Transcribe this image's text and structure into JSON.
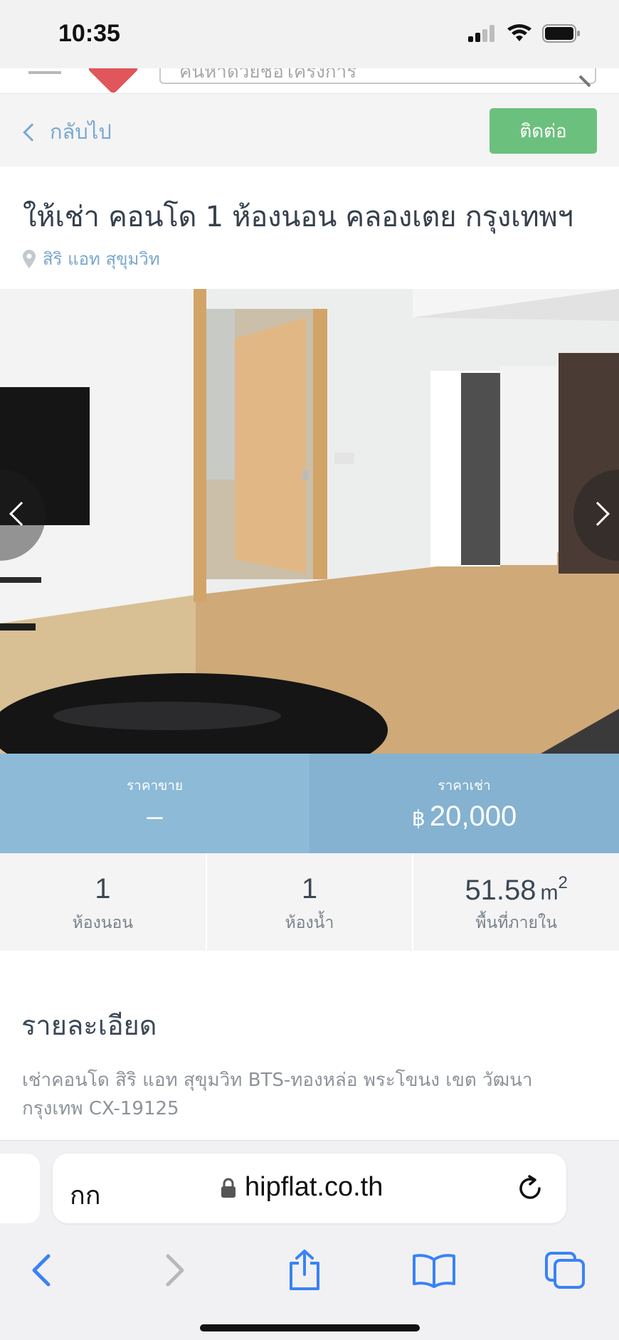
{
  "status_bar": {
    "time": "10:35"
  },
  "header": {
    "search_placeholder": "ค้นหาด้วยชื่อโครงการ"
  },
  "action_bar": {
    "back_label": "กลับไป",
    "contact_label": "ติดต่อ"
  },
  "listing": {
    "title": "ให้เช่า คอนโด 1 ห้องนอน คลองเตย กรุงเทพฯ",
    "location": "สิริ แอท สุขุมวิท"
  },
  "price": {
    "sale_label": "ราคาขาย",
    "sale_value": "–",
    "rent_label": "ราคาเช่า",
    "currency_symbol": "฿",
    "rent_value": "20,000"
  },
  "specs": [
    {
      "value": "1",
      "label": "ห้องนอน"
    },
    {
      "value": "1",
      "label": "ห้องน้ำ"
    },
    {
      "value": "51.58",
      "unit": "m",
      "unit_sup": "2",
      "label": "พื้นที่ภายใน"
    }
  ],
  "description": {
    "heading": "รายละเอียด",
    "text": "เช่าคอนโด สิริ แอท สุขุมวิท BTS-ทองหล่อ พระโขนง เขต วัฒนา กรุงเทพ CX-19125"
  },
  "browser": {
    "text_size_label": "กก",
    "url": "hipflat.co.th"
  },
  "colors": {
    "contact_button": "#6cc07d",
    "link_blue": "#79a9d2",
    "price_band_sale": "#8cbad7",
    "price_band_rent": "#84b2d0",
    "browser_blue": "#3a82f7"
  }
}
